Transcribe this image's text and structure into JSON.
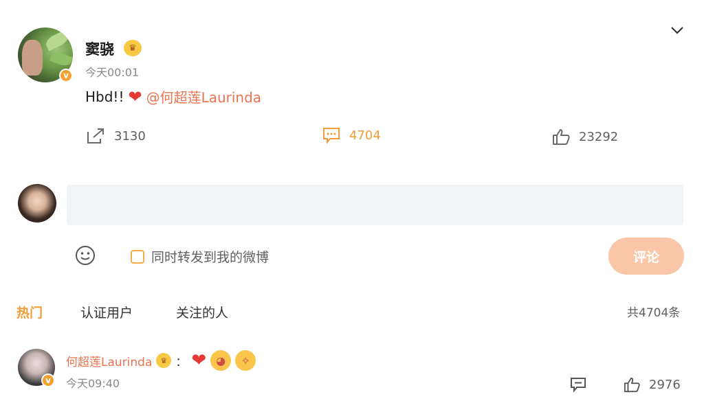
{
  "post": {
    "username": "窦骁",
    "timestamp": "今天00:01",
    "text": "Hbd!!",
    "mention": "@何超莲Laurinda",
    "reposts": "3130",
    "comments": "4704",
    "likes": "23292"
  },
  "composer": {
    "placeholder": "",
    "forward_label": "同时转发到我的微博",
    "submit_label": "评论"
  },
  "tabs": [
    "热门",
    "认证用户",
    "关注的人"
  ],
  "total_label": "共4704条",
  "comment": {
    "name": "何超莲Laurinda",
    "colon": "：",
    "timestamp": "今天09:40",
    "likes": "2976"
  },
  "colors": {
    "accent": "#f29b38",
    "mention": "#eb7350",
    "submit_bg": "#fbc6a8"
  },
  "icons": [
    "chevron-down-icon",
    "repost-icon",
    "comment-icon",
    "like-icon",
    "emoji-icon",
    "verified-badge-icon",
    "crown-icon",
    "heart-emoji",
    "kiss-emoji",
    "wink-emoji"
  ]
}
